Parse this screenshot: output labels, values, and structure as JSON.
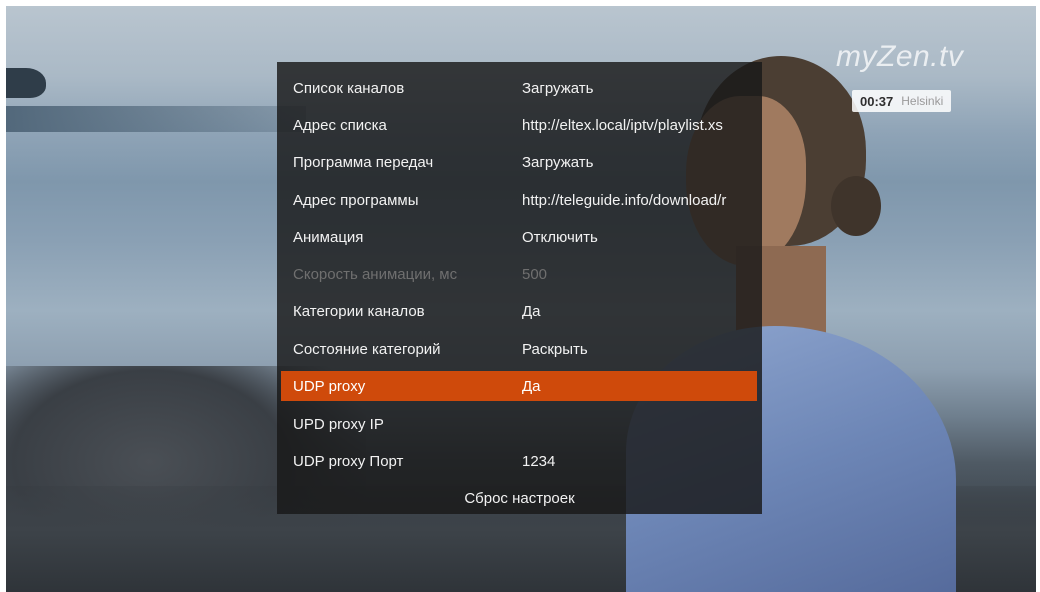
{
  "brand": {
    "logo_text": "myZen.tv"
  },
  "clock": {
    "time": "00:37",
    "city": "Helsinki"
  },
  "menu": {
    "items": [
      {
        "label": "Список каналов",
        "value": "Загружать"
      },
      {
        "label": "Адрес списка",
        "value": "http://eltex.local/iptv/playlist.xs"
      },
      {
        "label": "Программа передач",
        "value": "Загружать"
      },
      {
        "label": "Адрес программы",
        "value": "http://teleguide.info/download/r"
      },
      {
        "label": "Анимация",
        "value": "Отключить"
      },
      {
        "label": "Скорость анимации, мс",
        "value": "500"
      },
      {
        "label": "Категории каналов",
        "value": "Да"
      },
      {
        "label": "Состояние категорий",
        "value": "Раскрыть"
      },
      {
        "label": "UDP proxy",
        "value": "Да"
      },
      {
        "label": "UPD proxy IP",
        "value": ""
      },
      {
        "label": "UDP proxy Порт",
        "value": "1234"
      }
    ],
    "reset_label": "Сброс настроек",
    "selected_index": 8,
    "disabled_index": 5
  },
  "colors": {
    "accent": "#cf4a0b",
    "panel": "#181818",
    "disabled_text": "#6f6f6f"
  }
}
